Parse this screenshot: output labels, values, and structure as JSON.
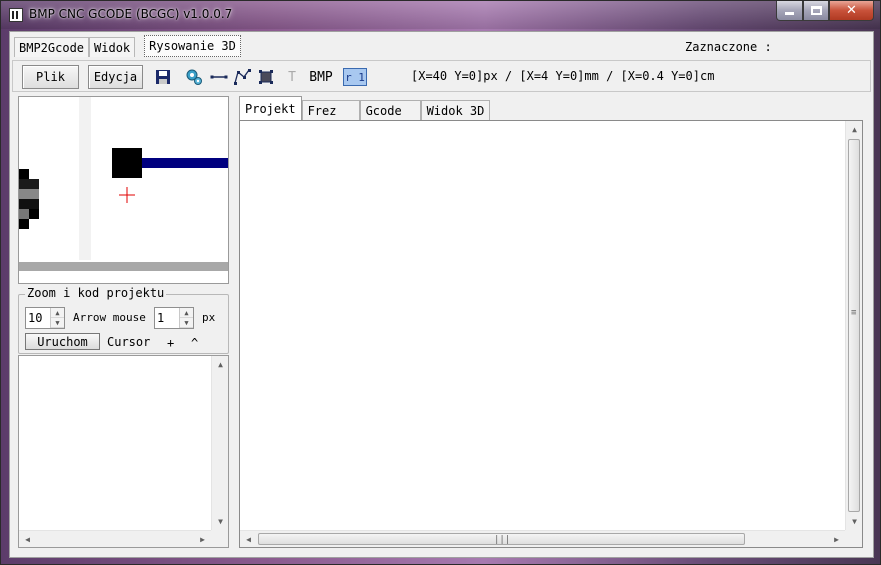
{
  "window": {
    "title": "BMP CNC GCODE (BCGC) v1.0.0.7",
    "min_label": "",
    "close_label": "✕"
  },
  "menu_tabs": [
    {
      "label": "BMP2Gcode"
    },
    {
      "label": "Widok"
    },
    {
      "label": "Rysowanie 3D"
    }
  ],
  "selected": {
    "label": "Zaznaczone :"
  },
  "toolbar": {
    "file_label": "Plik",
    "edit_label": "Edycja",
    "text_tool_label": "T",
    "bmp_label": "BMP",
    "ratio_label": "r 1",
    "coords": "[X=40 Y=0]px / [X=4 Y=0]mm / [X=0.4 Y=0]cm"
  },
  "zoom_group": {
    "title": "Zoom i kod projektu",
    "zoom_value": "10",
    "arrow_mouse_label": "Arrow mouse",
    "step_value": "1",
    "unit_label": "px",
    "run_label": "Uruchom",
    "cursor_label": "Cursor",
    "plus_label": "+",
    "caret_label": "^"
  },
  "work_tabs": [
    {
      "label": "Projekt"
    },
    {
      "label": "Frez"
    },
    {
      "label": "Gcode"
    },
    {
      "label": "Widok 3D"
    }
  ],
  "glyphs": {
    "up": "▲",
    "down": "▼",
    "left": "◀",
    "right": "▶",
    "grip_v": "≡",
    "grip_h": "|||"
  },
  "colors": {
    "accent_blue": "#00007f",
    "cursor_red": "#e00000"
  }
}
